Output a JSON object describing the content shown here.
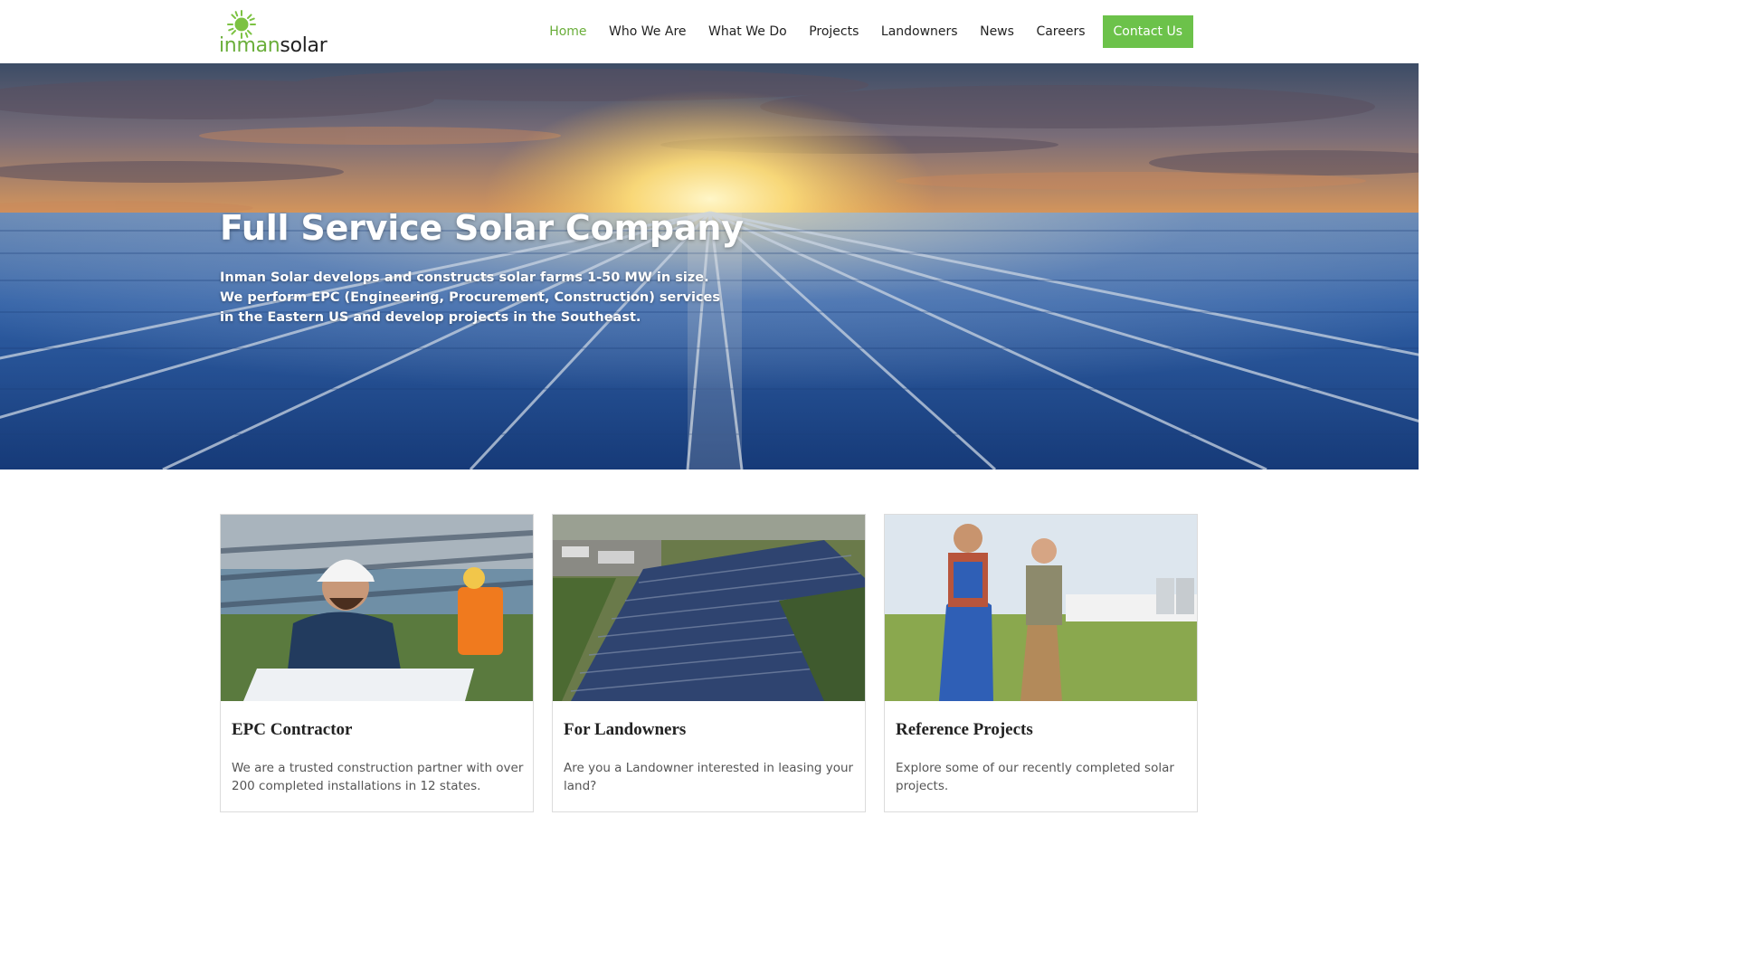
{
  "brand": {
    "logo_part1": "inman",
    "logo_part2": "solar",
    "accent_color": "#6aae3a",
    "button_color": "#6cc24a",
    "logo_icon": "sun-icon"
  },
  "nav": {
    "items": [
      {
        "label": "Home",
        "active": true
      },
      {
        "label": "Who We Are"
      },
      {
        "label": "What We Do"
      },
      {
        "label": "Projects"
      },
      {
        "label": "Landowners"
      },
      {
        "label": "News"
      },
      {
        "label": "Careers"
      }
    ],
    "cta_label": "Contact Us"
  },
  "hero": {
    "title": "Full Service Solar Company",
    "subtitle": "Inman Solar develops and constructs solar farms 1-50 MW in size. We perform EPC (Engineering, Procurement, Construction) services in the Eastern US and develop projects in the Southeast.",
    "image": "solar-panels-at-sunset"
  },
  "cards": [
    {
      "title": "EPC Contractor",
      "text": "We are a trusted construction partner with over 200 completed installations in 12 states.",
      "image": "workers-at-solar-site"
    },
    {
      "title": "For Landowners",
      "text": "Are you a Landowner interested in leasing your land?",
      "image": "aerial-solar-farm"
    },
    {
      "title": "Reference Projects",
      "text": "Explore some of our recently completed solar projects.",
      "image": "two-men-walking-in-field"
    }
  ]
}
